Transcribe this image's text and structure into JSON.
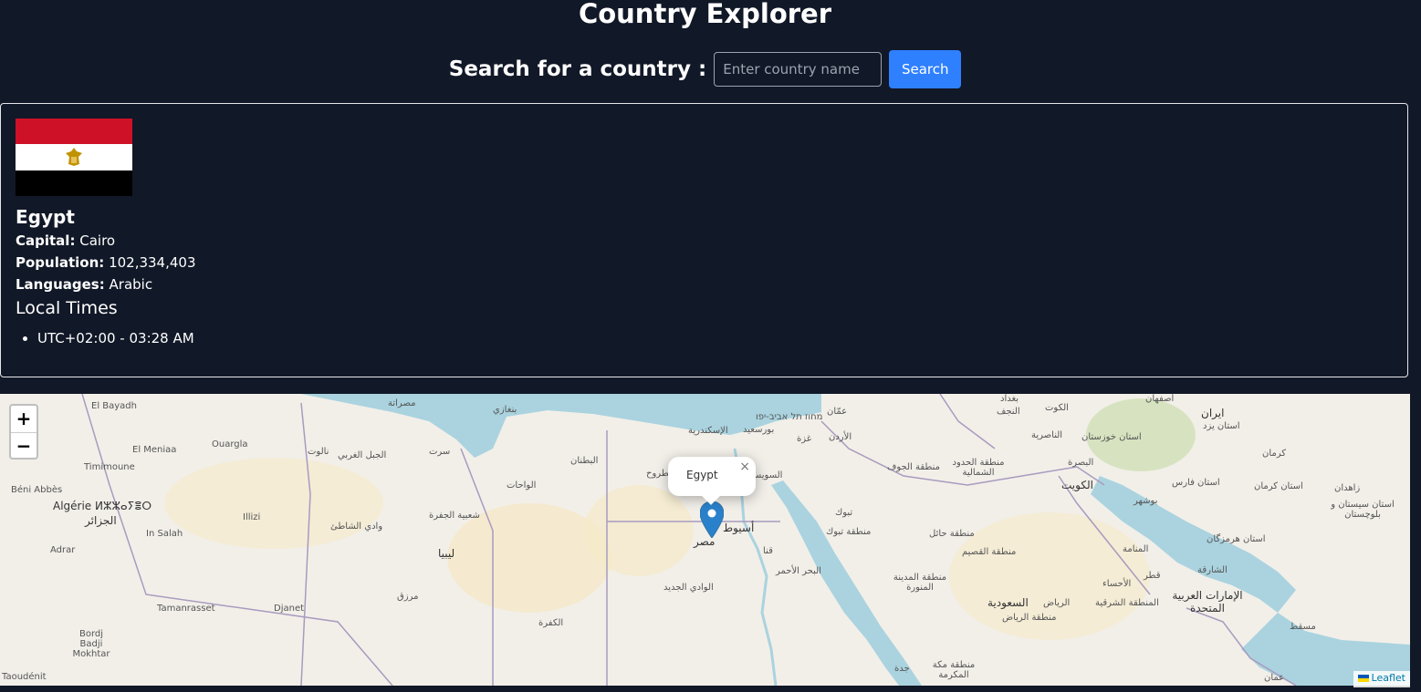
{
  "header": {
    "title": "Country Explorer"
  },
  "search": {
    "label": "Search for a country :",
    "placeholder": "Enter country name",
    "value": "",
    "button_label": "Search"
  },
  "country": {
    "name": "Egypt",
    "flag_colors": [
      "#ce1126",
      "#ffffff",
      "#000000"
    ],
    "flag_emblem_color": "#c09300",
    "capital_label": "Capital:",
    "capital": "Cairo",
    "population_label": "Population:",
    "population": "102,334,403",
    "languages_label": "Languages:",
    "languages": "Arabic",
    "local_times_heading": "Local Times",
    "local_times": [
      "UTC+02:00 - 03:28 AM"
    ]
  },
  "map": {
    "zoom_in": "+",
    "zoom_out": "−",
    "popup_text": "Egypt",
    "popup_close": "×",
    "attribution": "Leaflet",
    "marker_color": "#2a81cb",
    "water_color": "#aad3df",
    "land_color": "#f2efe9",
    "labels": [
      "El Bayadh",
      "El Meniaa",
      "Ouargla",
      "Timimoune",
      "Béni Abbès",
      "Algérie ⵍⵣⵣⴰⵢⴻⵔ",
      "الجزائر",
      "In Salah",
      "Illizi",
      "Adrar",
      "Tamanrasset",
      "Djanet",
      "Bordj Badji Mokhtar",
      "Taoudénit",
      "مصراتة",
      "بنغازي",
      "نالوت",
      "الجبل الغربي",
      "سرت",
      "البطنان",
      "الواحات",
      "شعبية الجفرة",
      "وادي الشاطئ",
      "ليبيا",
      "مرزق",
      "الكفرة",
      "الإسكندرية",
      "بورسعيد",
      "מחוז תל אביב-יפו",
      "عمّان",
      "غزة",
      "الأردن",
      "السويس",
      "مطروح",
      "أسيوط",
      "مصر",
      "قنا",
      "الوادي الجديد",
      "البحر الأحمر",
      "تبوك",
      "منطقة تبوك",
      "منطقة الجوف",
      "منطقة الحدود الشمالية",
      "منطقة حائل",
      "منطقة القصيم",
      "منطقة المدينة المنورة",
      "السعودية",
      "الرياض",
      "منطقة الرياض",
      "منطقة مكة المكرمة",
      "جدة",
      "بغداد",
      "النجف",
      "الكوت",
      "الناصرية",
      "البصرة",
      "الكويت",
      "أصفهان",
      "ايران",
      "استان یزد",
      "استان خوزستان",
      "کرمان",
      "استان فارس",
      "بوشهر",
      "استان کرمان",
      "زاهدان",
      "استان سیستان و بلوچستان",
      "استان هرمزگان",
      "المنامة",
      "الأحساء",
      "قطر",
      "الشارقة",
      "الإمارات العربية المتحدة",
      "المنطقة الشرقية",
      "مسقط",
      "عمان"
    ]
  }
}
